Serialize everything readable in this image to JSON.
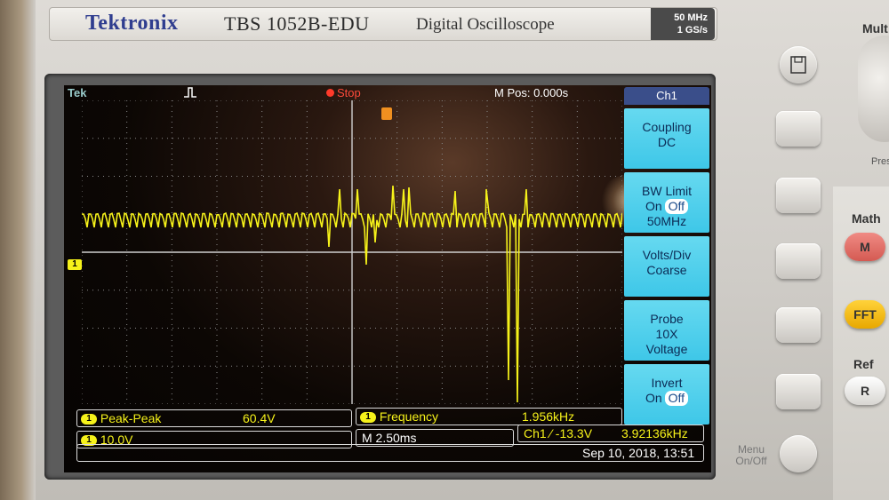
{
  "header": {
    "brand": "Tektronix",
    "model": "TBS 1052B-EDU",
    "description": "Digital Oscilloscope",
    "bandwidth": "50 MHz",
    "sample_rate": "1 GS/s"
  },
  "screen": {
    "top_bar": {
      "logo": "Tek",
      "run_state": "Stop",
      "mpos": "M Pos: 0.000s"
    },
    "channel_marker": "1",
    "menu": {
      "title": "Ch1",
      "items": [
        {
          "name": "Coupling",
          "value": "DC"
        },
        {
          "name": "BW Limit",
          "value_on": "On",
          "value_off": "Off",
          "value_extra": "50MHz"
        },
        {
          "name": "Volts/Div",
          "value": "Coarse"
        },
        {
          "name": "Probe",
          "value": "10X",
          "value_extra": "Voltage"
        },
        {
          "name": "Invert",
          "value_on": "On",
          "value_off": "Off"
        }
      ]
    },
    "readouts": {
      "peak_peak": {
        "channel": "1",
        "label": "Peak-Peak",
        "value": "60.4V"
      },
      "frequency": {
        "channel": "1",
        "label": "Frequency",
        "value": "1.956kHz"
      },
      "volts_div": {
        "channel": "1",
        "value": "10.0V"
      },
      "timebase": "M 2.50ms",
      "trigger": "Ch1 ⁄ -13.3V",
      "trigger_freq": "3.92136kHz",
      "datetime": "Sep 10, 2018, 13:51"
    }
  },
  "right_panel": {
    "multi_label": "Mult",
    "press_label": "Pres",
    "math_label": "Math",
    "math_button": "M",
    "fft_button": "FFT",
    "ref_label": "Ref",
    "ref_button": "R",
    "menu_onoff": "Menu On/Off"
  },
  "colors": {
    "trace": "#f6f21a",
    "menu_item": "#3ec7e8",
    "stop": "#ff4a3a",
    "brand": "#2f3d8f"
  }
}
